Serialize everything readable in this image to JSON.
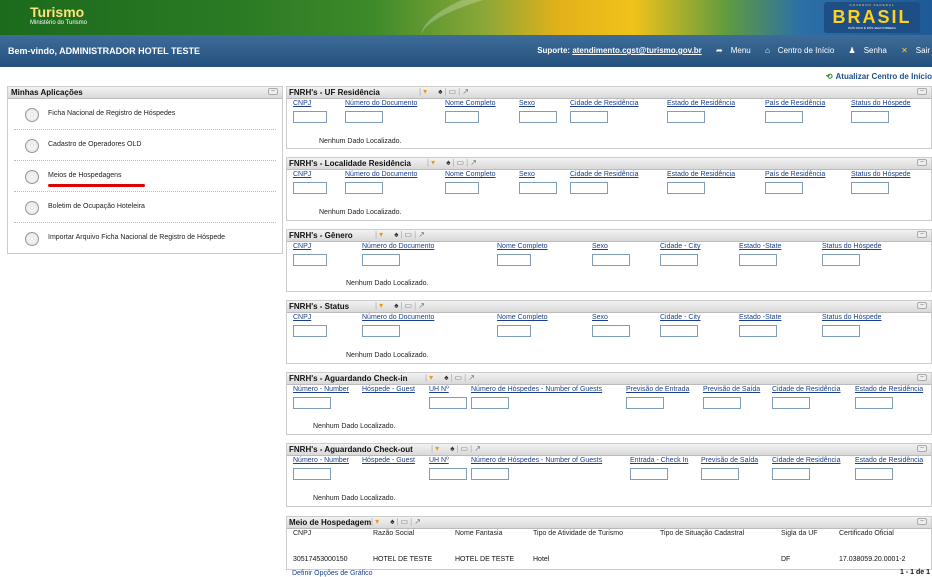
{
  "header": {
    "app_title": "Turismo",
    "app_subtitle": "Ministério do Turismo",
    "logo_word": "BRASIL",
    "logo_top": "GOVERNO FEDERAL",
    "logo_bottom": "PAÍS RICO É PAÍS SEM POBREZA"
  },
  "topbar": {
    "welcome": "Bem-vindo, ADMINISTRADOR HOTEL TESTE",
    "support_label": "Suporte:",
    "support_email": "atendimento.cgst@turismo.gov.br",
    "menu": "Menu",
    "home": "Centro de Início",
    "password": "Senha",
    "logout": "Sair"
  },
  "refresh_label": "Atualizar Centro de Início",
  "apps": {
    "title": "Minhas Aplicações",
    "items": [
      {
        "label": "Ficha Nacional de Registro de Hóspedes"
      },
      {
        "label": "Cadastro de Operadores OLD"
      },
      {
        "label": "Meios de Hospedagens"
      },
      {
        "label": "Boletim de Ocupação Hoteleira"
      },
      {
        "label": "Importar Arquivo Ficha Nacional de Registro de Hóspede"
      }
    ]
  },
  "empty_text": "Nenhum Dado Localizado.",
  "panels": [
    {
      "title": "FNRH's - UF Residência",
      "columns": [
        "CNPJ",
        "Número do Documento",
        "Nome Completo",
        "Sexo",
        "Cidade de Residência",
        "Estado de Residência",
        "País de Residência",
        "Status do Hóspede"
      ]
    },
    {
      "title": "FNRH's - Localidade Residência",
      "columns": [
        "CNPJ",
        "Número do Documento",
        "Nome Completo",
        "Sexo",
        "Cidade de Residência",
        "Estado de Residência",
        "País de Residência",
        "Status do Hóspede"
      ]
    },
    {
      "title": "FNRH's - Gênero",
      "columns": [
        "CNPJ",
        "Número do Documento",
        "Nome Completo",
        "Sexo",
        "Cidade - City",
        "Estado -State",
        "Status do Hóspede"
      ]
    },
    {
      "title": "FNRH's - Status",
      "columns": [
        "CNPJ",
        "Número do Documento",
        "Nome Completo",
        "Sexo",
        "Cidade - City",
        "Estado -State",
        "Status do Hóspede"
      ]
    },
    {
      "title": "FNRH's - Aguardando Check-in",
      "columns": [
        "Número - Number",
        "Hóspede - Guest",
        "UH Nº",
        "Número de Hóspedes - Number of Guests",
        "Previsão de Entrada",
        "Previsão de Saída",
        "Cidade de Residência",
        "Estado de Residência"
      ]
    },
    {
      "title": "FNRH's - Aguardando Check-out",
      "columns": [
        "Número - Number",
        "Hóspede - Guest",
        "UH Nº",
        "Número de Hóspedes - Number of Guests",
        "Entrada - Check In",
        "Previsão de Saída",
        "Cidade de Residência",
        "Estado de Residência"
      ]
    }
  ],
  "hotels": {
    "title": "Meio de Hospedagem",
    "columns": [
      "CNPJ",
      "Razão Social",
      "Nome Fantasia",
      "Tipo de Atividade de Turismo",
      "Tipo de Situação Cadastral",
      "Sigla da UF",
      "Certificado Oficial"
    ],
    "rows": [
      [
        "30517453000150",
        "HOTEL DE TESTE",
        "HOTEL DE TESTE",
        "Hotel",
        "",
        "DF",
        "17.038059.20.0001-2"
      ]
    ],
    "chart_options": "Definir Opções de Gráfico",
    "paging": "1 - 1 de 1"
  },
  "colors": {
    "header_blue": "#24507e",
    "link_blue": "#1a3f8c",
    "highlight_red": "#e00000"
  }
}
